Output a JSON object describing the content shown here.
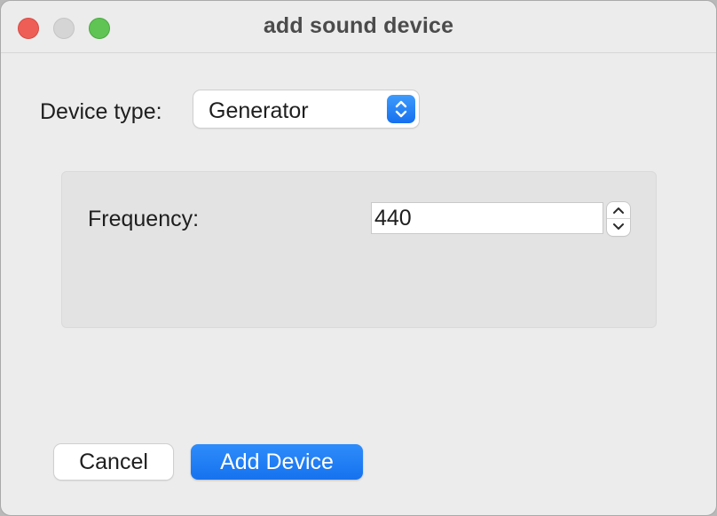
{
  "window": {
    "title": "add sound device"
  },
  "form": {
    "device_type_label": "Device type:",
    "device_type_value": "Generator",
    "frequency_label": "Frequency:",
    "frequency_value": "440"
  },
  "buttons": {
    "cancel_label": "Cancel",
    "add_label": "Add Device"
  },
  "colors": {
    "accent": "#1a7cf5",
    "close": "#ee5e57",
    "minimize": "#d5d5d5",
    "maximize": "#5fc454"
  },
  "icons": {
    "popup": "chevron-up-down-icon",
    "step_up": "chevron-up-icon",
    "step_down": "chevron-down-icon"
  }
}
